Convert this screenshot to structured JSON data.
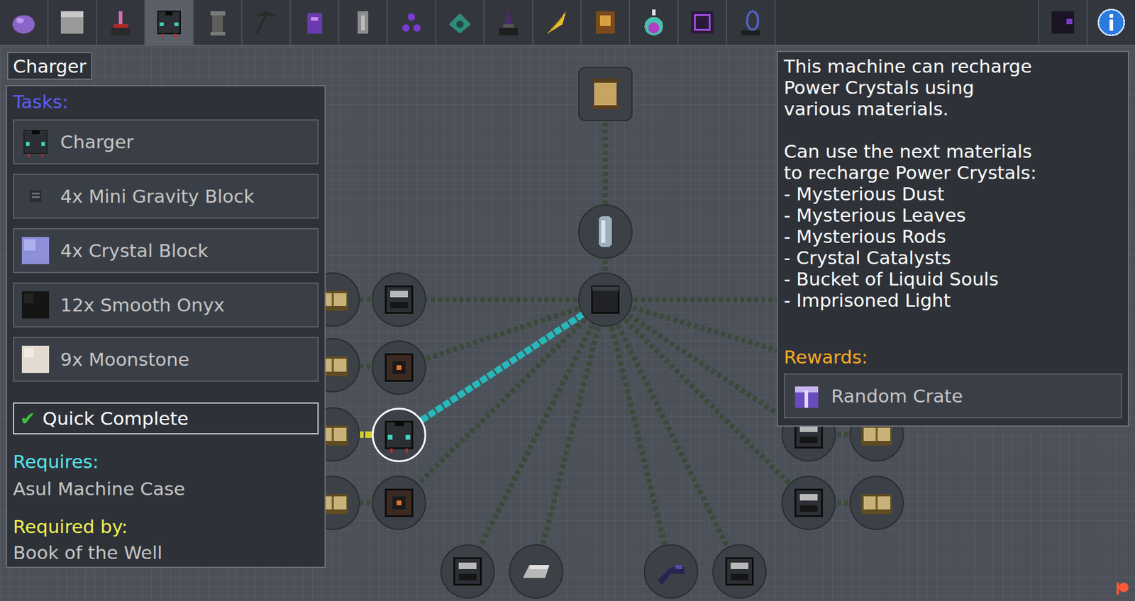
{
  "chapters": [
    {
      "selected": false
    },
    {
      "selected": false
    },
    {
      "selected": false
    },
    {
      "selected": true
    },
    {
      "selected": false
    },
    {
      "selected": false
    },
    {
      "selected": false
    },
    {
      "selected": false
    },
    {
      "selected": false
    },
    {
      "selected": false
    },
    {
      "selected": false
    },
    {
      "selected": false
    },
    {
      "selected": false
    },
    {
      "selected": false
    },
    {
      "selected": false
    },
    {
      "selected": false
    }
  ],
  "quest": {
    "title": "Charger",
    "tasks_label": "Tasks:",
    "tasks": [
      {
        "label": "Charger"
      },
      {
        "label": "4x Mini Gravity Block"
      },
      {
        "label": "4x Crystal Block"
      },
      {
        "label": "12x Smooth Onyx"
      },
      {
        "label": "9x Moonstone"
      }
    ],
    "quick_complete": {
      "check": "✔",
      "label": "Quick Complete"
    },
    "requires_label": "Requires:",
    "requires": "Asul Machine Case",
    "required_by_label": "Required by:",
    "required_by": "Book of the Well",
    "description": [
      [
        "This machine can recharge",
        "Power Crystals using",
        "various materials."
      ],
      [
        "Can use the next materials",
        "to recharge Power Crystals:",
        "- Mysterious Dust",
        "- Mysterious Leaves",
        "- Mysterious Rods",
        "- Crystal Catalysts",
        "- Bucket of Liquid Souls",
        "- Imprisoned Light"
      ]
    ],
    "rewards_label": "Rewards:",
    "rewards": [
      {
        "label": "Random Crate"
      }
    ]
  },
  "quest_nodes": [
    {
      "kind": "scroll",
      "selected": false
    },
    {
      "kind": "vial",
      "selected": false
    },
    {
      "kind": "block",
      "selected": false
    },
    {
      "kind": "book",
      "selected": false
    },
    {
      "kind": "machine",
      "selected": false
    },
    {
      "kind": "book",
      "selected": false
    },
    {
      "kind": "furnace",
      "selected": false
    },
    {
      "kind": "book",
      "selected": false
    },
    {
      "kind": "charger",
      "selected": true
    },
    {
      "kind": "book",
      "selected": false
    },
    {
      "kind": "furnace",
      "selected": false
    },
    {
      "kind": "machine",
      "selected": false
    },
    {
      "kind": "ingot",
      "selected": false
    },
    {
      "kind": "tool",
      "selected": false
    },
    {
      "kind": "machine",
      "selected": false
    },
    {
      "kind": "machine",
      "selected": false
    },
    {
      "kind": "book",
      "selected": false
    },
    {
      "kind": "machine",
      "selected": false
    },
    {
      "kind": "book",
      "selected": false
    }
  ]
}
